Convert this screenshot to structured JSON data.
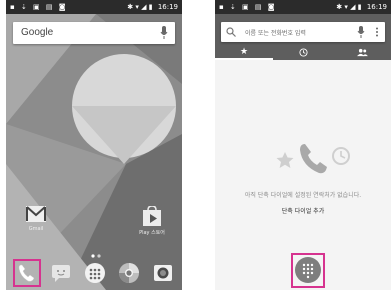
{
  "left_screen": {
    "status_bar": {
      "time": "16:19",
      "left_icons": [
        "sim-icon",
        "download-icon",
        "image-icon",
        "folder-icon",
        "screenshot-icon"
      ],
      "right_icons": [
        "bluetooth-icon",
        "wifi-icon",
        "signal-icon",
        "battery-icon"
      ]
    },
    "search": {
      "logo": "Google",
      "icon": "mic-icon"
    },
    "apps": [
      {
        "label": "Gmail",
        "icon": "gmail-icon"
      },
      {
        "label": "Play 스토어",
        "icon": "play-store-icon"
      }
    ],
    "dock": [
      "phone-icon",
      "messages-icon",
      "app-drawer-icon",
      "browser-icon",
      "camera-icon"
    ],
    "highlighted": "phone-icon",
    "highlight_color": "#d6338f"
  },
  "right_screen": {
    "status_bar": {
      "time": "16:19"
    },
    "search": {
      "placeholder": "이름 또는 전화번호 입력"
    },
    "tabs": [
      {
        "icon": "star-icon",
        "selected": true
      },
      {
        "icon": "clock-icon",
        "selected": false
      },
      {
        "icon": "contacts-icon",
        "selected": false
      }
    ],
    "empty_message": "아직 단축 다이얼에 설정된 연락처가 없습니다.",
    "add_link": "단축 다이얼 추가",
    "fab_icon": "dialpad-icon",
    "highlight_color": "#d6338f"
  }
}
